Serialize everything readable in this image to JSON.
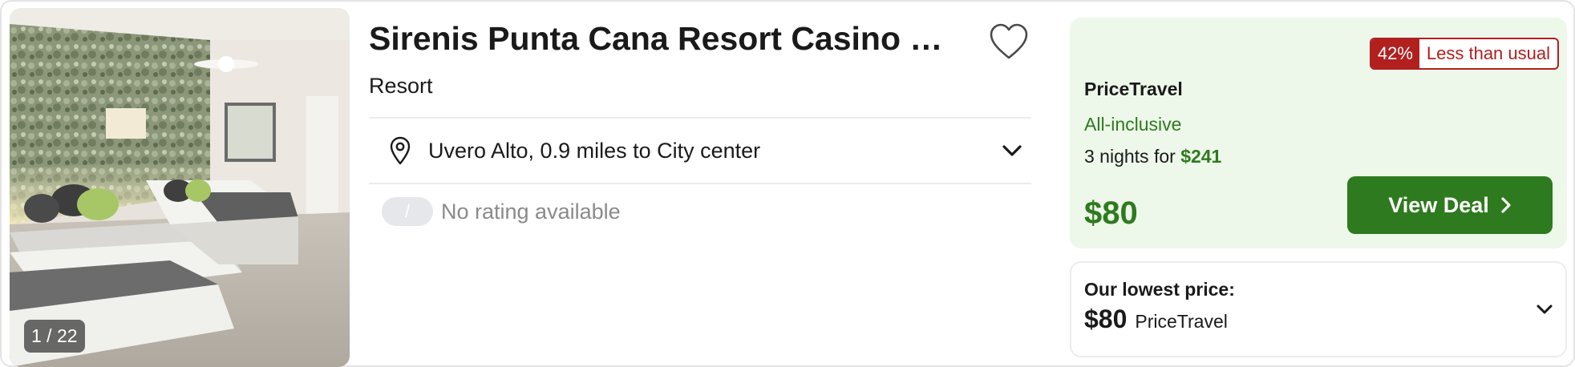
{
  "hotel": {
    "name": "Sirenis Punta Cana Resort Casino & Aq...",
    "type": "Resort",
    "location": "Uvero Alto, 0.9 miles to City center",
    "rating_pill": "/",
    "rating_text": "No rating available"
  },
  "gallery": {
    "counter": "1 / 22",
    "image_icon": "hotel-room-photo"
  },
  "icons": {
    "favorite": "heart-outline-icon",
    "location": "map-pin-icon",
    "expand": "chevron-down-icon",
    "next": "chevron-right-icon"
  },
  "deal": {
    "badge_percent": "42%",
    "badge_text": "Less than usual",
    "provider": "PriceTravel",
    "board": "All-inclusive",
    "nights_prefix": "3 nights for",
    "nights_total": "$241",
    "nightly_price": "$80",
    "cta_label": "View Deal"
  },
  "lowest": {
    "label": "Our lowest price:",
    "price": "$80",
    "provider": "PriceTravel"
  },
  "colors": {
    "accent_green": "#2e7a1e",
    "deal_bg": "#eef8ea",
    "badge_red": "#b11f1f",
    "muted": "#8a8a8a"
  }
}
